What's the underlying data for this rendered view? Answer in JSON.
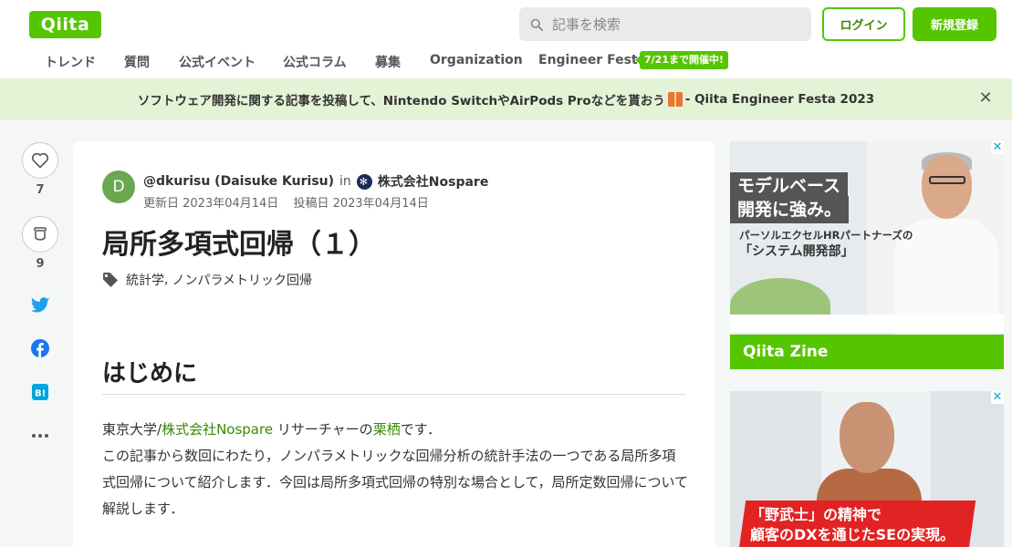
{
  "header": {
    "logo": "Qiita",
    "search_placeholder": "記事を検索",
    "login_label": "ログイン",
    "signup_label": "新規登録"
  },
  "nav": {
    "items": [
      "トレンド",
      "質問",
      "公式イベント",
      "公式コラム",
      "募集",
      "Organization",
      "Engineer Festa"
    ],
    "badge": "7/21まで開催中!"
  },
  "banner": {
    "text_before": "ソフトウェア開発に関する記事を投稿して、Nintendo SwitchやAirPods Proなどを貰おう",
    "text_after": " - Qiita Engineer Festa 2023"
  },
  "rail": {
    "likes": "7",
    "stocks": "9"
  },
  "article": {
    "avatar_letter": "D",
    "author": "@dkurisu (Daisuke Kurisu)",
    "in": "in",
    "org": "株式会社Nospare",
    "updated": "更新日 2023年04月14日",
    "posted": "投稿日 2023年04月14日",
    "title": "局所多項式回帰（１）",
    "tags": [
      "統計学",
      "ノンパラメトリック回帰"
    ],
    "heading": "はじめに",
    "p1_a": "東京大学/",
    "p1_link1": "株式会社Nospare",
    "p1_b": " リサーチャーの",
    "p1_link2": "栗栖",
    "p1_c": "です．",
    "p2": "この記事から数回にわたり，ノンパラメトリックな回帰分析の統計手法の一つである局所多項式回帰について紹介します．今回は局所多項式回帰の特別な場合として，局所定数回帰について解説します．"
  },
  "ads": {
    "ad1": {
      "line1": "モデルベース",
      "line2": "開発に強み。",
      "line3": "パーソルエクセルHRパートナーズの",
      "line4": "「システム開発部」",
      "brand": "Qiita Zine"
    },
    "ad2": {
      "line1": "「野武士」の精神で",
      "line2": "顧客のDXを通じたSEの実現。"
    },
    "close_glyph": "✕"
  },
  "colors": {
    "brand_green": "#55c500",
    "banner_bg": "#e3f3d5",
    "link_green": "#3a8a00"
  }
}
